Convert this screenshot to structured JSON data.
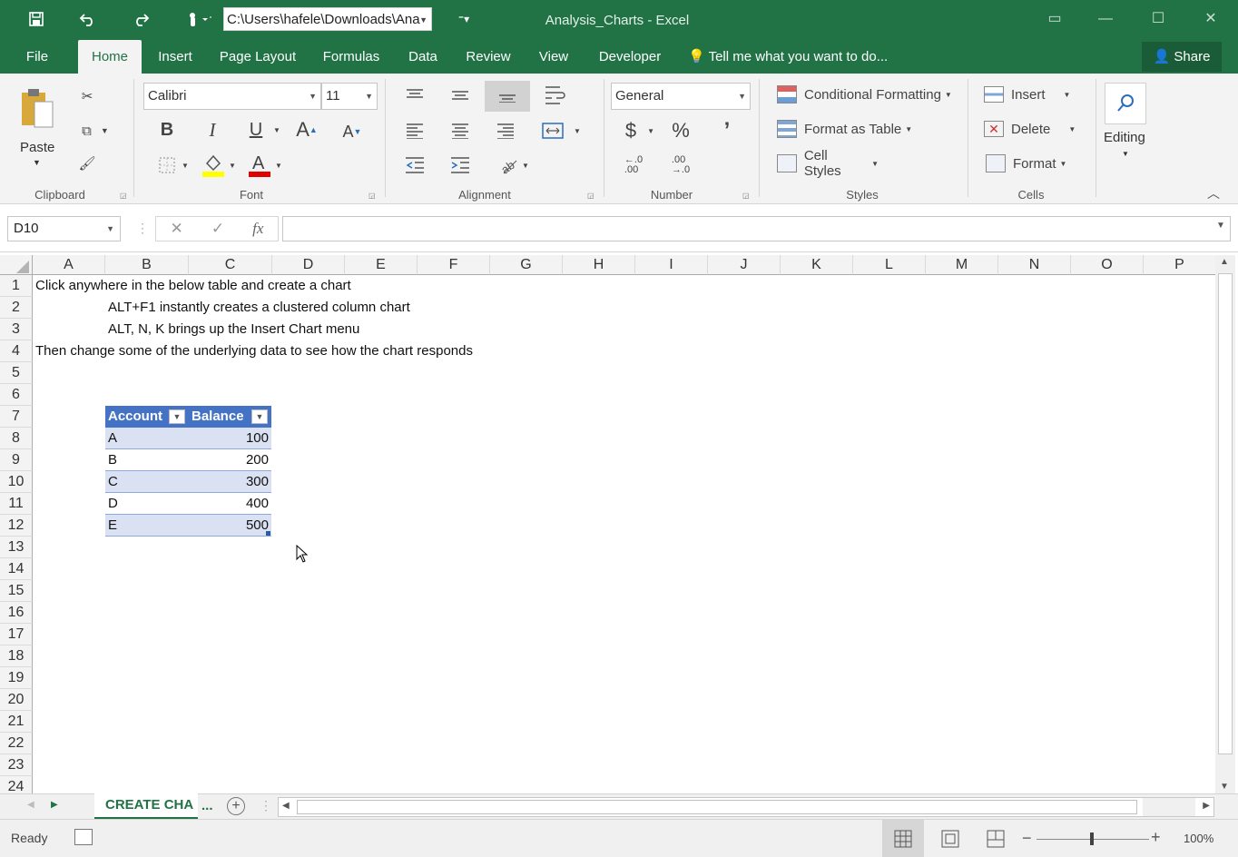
{
  "app": {
    "file_path": "C:\\Users\\hafele\\Downloads\\Ana",
    "window_title": "Analysis_Charts - Excel"
  },
  "ribbon_tabs": [
    "File",
    "Home",
    "Insert",
    "Page Layout",
    "Formulas",
    "Data",
    "Review",
    "View",
    "Developer"
  ],
  "tell_me": "Tell me what you want to do...",
  "share_label": "Share",
  "clipboard": {
    "paste_label": "Paste",
    "group_label": "Clipboard"
  },
  "font": {
    "name": "Calibri",
    "size": "11",
    "group_label": "Font",
    "bold": "B",
    "italic": "I",
    "underline": "U"
  },
  "alignment": {
    "group_label": "Alignment"
  },
  "number": {
    "format": "General",
    "currency": "$",
    "percent": "%",
    "comma": "’",
    "group_label": "Number",
    "inc_decimal": "←.0\n.00",
    "dec_decimal": ".00\n→.0"
  },
  "styles": {
    "conditional": "Conditional Formatting",
    "format_table": "Format as Table",
    "cell_styles": "Cell Styles",
    "group_label": "Styles"
  },
  "cells": {
    "insert": "Insert",
    "delete": "Delete",
    "format": "Format",
    "group_label": "Cells"
  },
  "editing": {
    "label": "Editing"
  },
  "formula_bar": {
    "name_box": "D10",
    "formula": ""
  },
  "columns": [
    "A",
    "B",
    "C",
    "D",
    "E",
    "F",
    "G",
    "H",
    "I",
    "J",
    "K",
    "L",
    "M",
    "N",
    "O",
    "P"
  ],
  "rows": [
    "1",
    "2",
    "3",
    "4",
    "5",
    "6",
    "7",
    "8",
    "9",
    "10",
    "11",
    "12",
    "13",
    "14",
    "15",
    "16",
    "17",
    "18",
    "19",
    "20",
    "21",
    "22",
    "23",
    "24"
  ],
  "sheet_text": {
    "r1": "Click anywhere in the below table and create a chart",
    "r2": "ALT+F1 instantly creates a clustered column chart",
    "r3": "ALT, N, K brings up the Insert Chart menu",
    "r4": "Then change some of the underlying data to see how the chart responds"
  },
  "table": {
    "headers": [
      "Account",
      "Balance"
    ],
    "rows": [
      {
        "account": "A",
        "balance": "100"
      },
      {
        "account": "B",
        "balance": "200"
      },
      {
        "account": "C",
        "balance": "300"
      },
      {
        "account": "D",
        "balance": "400"
      },
      {
        "account": "E",
        "balance": "500"
      }
    ],
    "header_color": "#4472c4",
    "band_color": "#d9e1f2"
  },
  "sheet_tab": "CREATE CHA",
  "sheet_tab_more": "...",
  "status": {
    "ready": "Ready",
    "zoom": "100%"
  },
  "colors": {
    "excel_green": "#217346"
  }
}
